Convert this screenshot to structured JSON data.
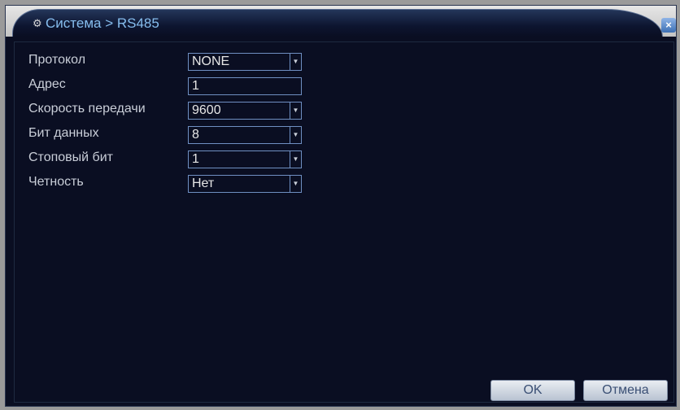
{
  "window": {
    "title_icon": "system-icon",
    "title": "Система > RS485",
    "close_label": "×"
  },
  "fields": [
    {
      "label": "Протокол",
      "value": "NONE",
      "type": "select"
    },
    {
      "label": "Адрес",
      "value": "1",
      "type": "text"
    },
    {
      "label": "Скорость передачи",
      "value": "9600",
      "type": "select"
    },
    {
      "label": "Бит данных",
      "value": "8",
      "type": "select"
    },
    {
      "label": "Стоповый бит",
      "value": "1",
      "type": "select"
    },
    {
      "label": "Четность",
      "value": "Нет",
      "type": "select"
    }
  ],
  "buttons": {
    "ok_label": "OK",
    "cancel_label": "Отмена"
  },
  "colors": {
    "background": "#0a0e22",
    "title_text": "#86bdee",
    "field_border": "#6f8fc2",
    "label_text": "#c9ced8"
  }
}
